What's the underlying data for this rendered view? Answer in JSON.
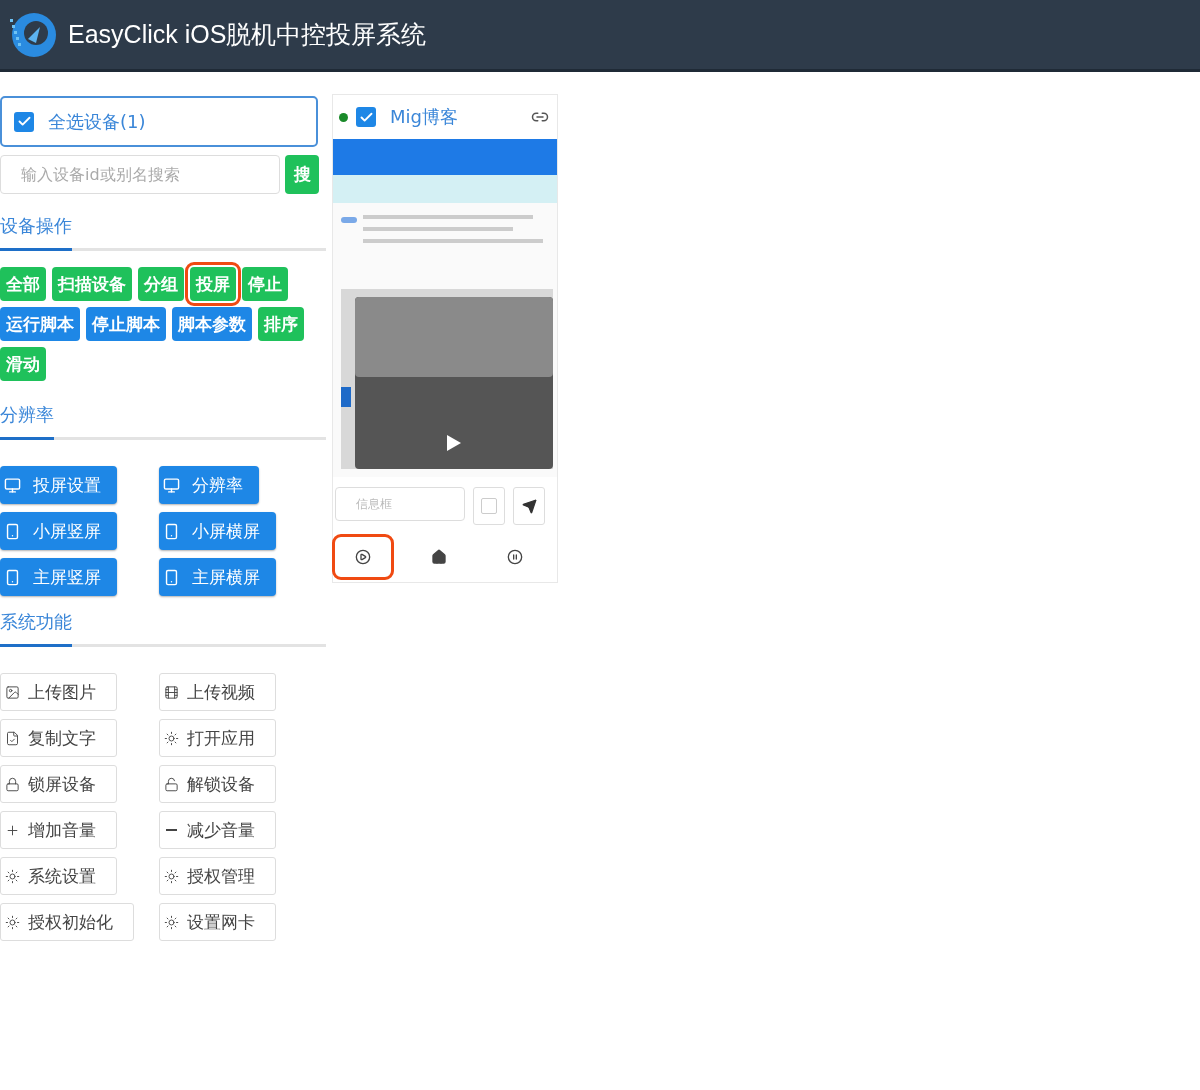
{
  "header": {
    "title": "EasyClick iOS脱机中控投屏系统"
  },
  "select_all": {
    "label": "全选设备(1)",
    "checked": true
  },
  "search": {
    "placeholder": "输入设备id或别名搜索",
    "button": "搜"
  },
  "sections": [
    {
      "title": "设备操作",
      "buttons": [
        {
          "label": "全部",
          "color": "#1fc15b",
          "highlighted": false
        },
        {
          "label": "扫描设备",
          "color": "#1fc15b",
          "highlighted": false
        },
        {
          "label": "分组",
          "color": "#1fc15b",
          "highlighted": false
        },
        {
          "label": "投屏",
          "color": "#1fc15b",
          "highlighted": true
        },
        {
          "label": "停止",
          "color": "#1fc15b",
          "highlighted": false
        },
        {
          "label": "运行脚本",
          "color": "#1e87e6",
          "highlighted": false
        },
        {
          "label": "停止脚本",
          "color": "#1e87e6",
          "highlighted": false
        },
        {
          "label": "脚本参数",
          "color": "#1e87e6",
          "highlighted": false
        },
        {
          "label": "排序",
          "color": "#1fc15b",
          "highlighted": false
        },
        {
          "label": "滑动",
          "color": "#1fc15b",
          "highlighted": false
        }
      ]
    },
    {
      "title": "分辨率",
      "buttons": [
        {
          "label": "投屏设置"
        },
        {
          "label": "分辨率"
        },
        {
          "label": "小屏竖屏"
        },
        {
          "label": "小屏横屏"
        },
        {
          "label": "主屏竖屏"
        },
        {
          "label": "主屏横屏"
        }
      ]
    },
    {
      "title": "系统功能",
      "buttons": [
        {
          "label": "上传图片"
        },
        {
          "label": "上传视频"
        },
        {
          "label": "复制文字"
        },
        {
          "label": "打开应用"
        },
        {
          "label": "锁屏设备"
        },
        {
          "label": "解锁设备"
        },
        {
          "label": "增加音量"
        },
        {
          "label": "减少音量"
        },
        {
          "label": "系统设置"
        },
        {
          "label": "授权管理"
        },
        {
          "label": "授权初始化"
        },
        {
          "label": "设置网卡"
        }
      ]
    }
  ],
  "device": {
    "name": "Mig博客",
    "online": true,
    "checked": true,
    "message": {
      "placeholder": "信息框"
    },
    "option_checked": false,
    "controls": [
      {
        "kind": "play",
        "highlighted": true
      },
      {
        "kind": "home",
        "highlighted": false
      },
      {
        "kind": "pause",
        "highlighted": false
      }
    ]
  }
}
